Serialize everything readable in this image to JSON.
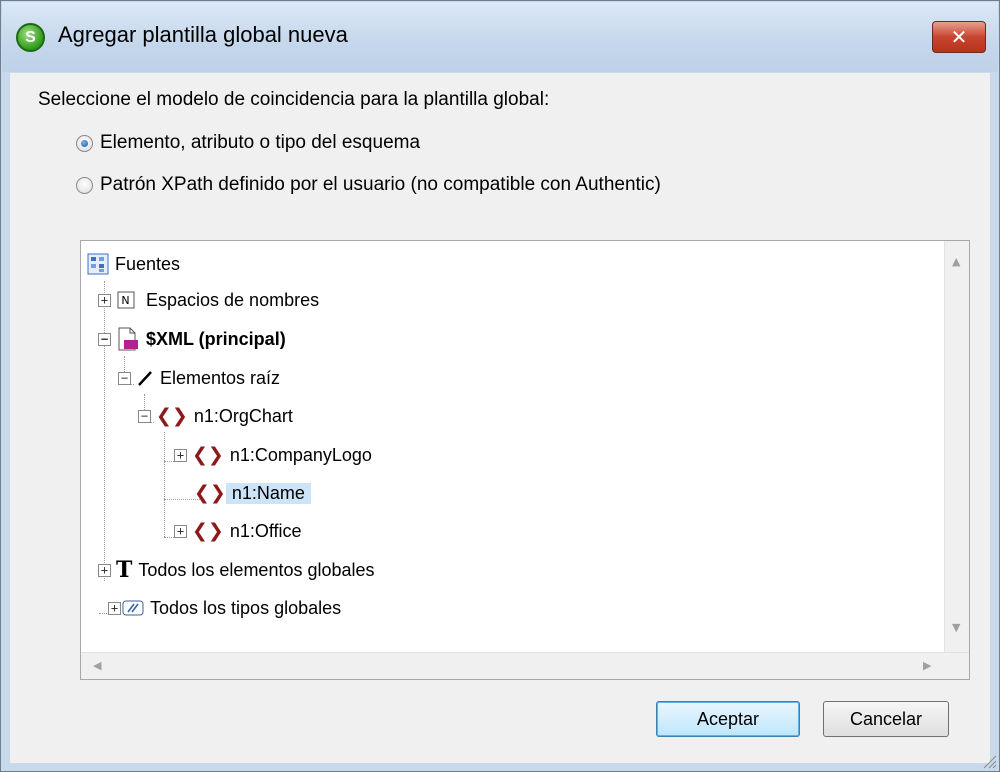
{
  "window": {
    "title": "Agregar plantilla global nueva",
    "close_glyph": "✕"
  },
  "prompt": "Seleccione el modelo de coincidencia para la plantilla global:",
  "options": [
    {
      "label": "Elemento, atributo o tipo del esquema",
      "selected": true
    },
    {
      "label": "Patrón XPath definido por el usuario (no compatible con Authentic)",
      "selected": false
    }
  ],
  "tree": {
    "root": {
      "label": "Fuentes",
      "icon": "sources-icon"
    },
    "namespaces": {
      "label": "Espacios de nombres",
      "icon": "namespace-icon",
      "icon_text": "N",
      "expander": "+"
    },
    "xml": {
      "label": "$XML (principal)",
      "icon": "xml-document-icon",
      "expander": "−"
    },
    "root_elements": {
      "label": "Elementos raíz",
      "icon": "slash-icon",
      "expander": "−"
    },
    "orgchart": {
      "label": "n1:OrgChart",
      "icon": "element-icon",
      "expander": "−"
    },
    "companylogo": {
      "label": "n1:CompanyLogo",
      "icon": "element-icon",
      "expander": "+"
    },
    "name": {
      "label": "n1:Name",
      "icon": "element-icon",
      "selected": true
    },
    "office": {
      "label": "n1:Office",
      "icon": "element-icon",
      "expander": "+"
    },
    "global_elements": {
      "label": "Todos los elementos globales",
      "icon": "type-t-icon",
      "icon_text": "T",
      "expander": "+"
    },
    "global_types": {
      "label": "Todos los tipos globales",
      "icon": "global-types-icon",
      "expander": "+"
    }
  },
  "element_glyph": "❮❯",
  "buttons": {
    "ok": "Aceptar",
    "cancel": "Cancelar"
  },
  "colors": {
    "selection": "#cde3f7",
    "element_icon": "#8b1a1a",
    "accent": "#3c7fb1"
  }
}
